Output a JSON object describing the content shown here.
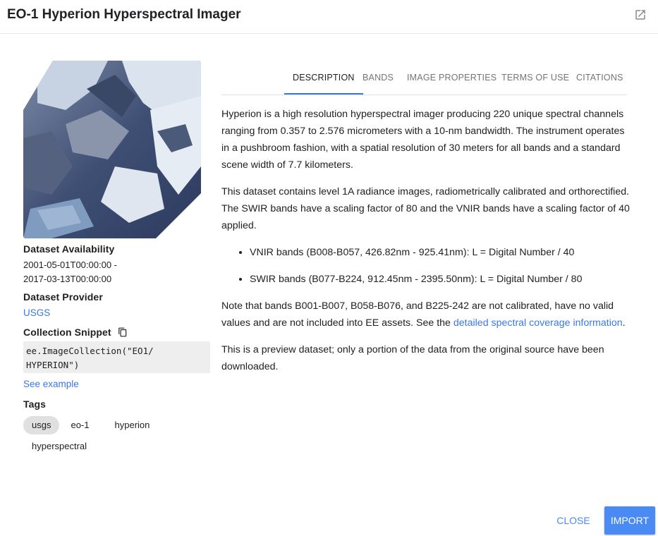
{
  "header": {
    "title": "EO-1 Hyperion Hyperspectral Imager",
    "open_icon": "open-in-new-icon"
  },
  "sidebar": {
    "availability_label": "Dataset Availability",
    "availability_start": "2001-05-01T00:00:00 -",
    "availability_end": "2017-03-13T00:00:00",
    "provider_label": "Dataset Provider",
    "provider_link": "USGS",
    "snippet_label": "Collection Snippet",
    "snippet_line1": "ee.ImageCollection(\"EO1/",
    "snippet_line2": "HYPERION\")",
    "see_example": "See example",
    "tags_label": "Tags",
    "tags": [
      "usgs",
      "eo-1",
      "hyperion",
      "hyperspectral"
    ]
  },
  "tabs": [
    "DESCRIPTION",
    "BANDS",
    "IMAGE PROPERTIES",
    "TERMS OF USE",
    "CITATIONS"
  ],
  "description": {
    "p1": "Hyperion is a high resolution hyperspectral imager producing 220 unique spectral channels ranging from 0.357 to 2.576 micrometers with a 10-nm bandwidth. The instrument operates in a pushbroom fashion, with a spatial resolution of 30 meters for all bands and a standard scene width of 7.7 kilometers.",
    "p2": "This dataset contains level 1A radiance images, radiometrically calibrated and orthorectified. The SWIR bands have a scaling factor of 80 and the VNIR bands have a scaling factor of 40 applied.",
    "bullet1": "VNIR bands (B008-B057, 426.82nm - 925.41nm): L = Digital Number / 40",
    "bullet2": "SWIR bands (B077-B224, 912.45nm - 2395.50nm): L = Digital Number / 80",
    "p3_text": "Note that bands B001-B007, B058-B076, and B225-242 are not calibrated, have no valid values and are not included into EE assets. See the ",
    "p3_link": "detailed spectral coverage information",
    "p3_end": ".",
    "p4": "This is a preview dataset; only a portion of the data from the original source have been downloaded."
  },
  "footer": {
    "close": "CLOSE",
    "import": "IMPORT"
  },
  "colors": {
    "accent": "#4a8af4",
    "link": "#3b78e7"
  }
}
